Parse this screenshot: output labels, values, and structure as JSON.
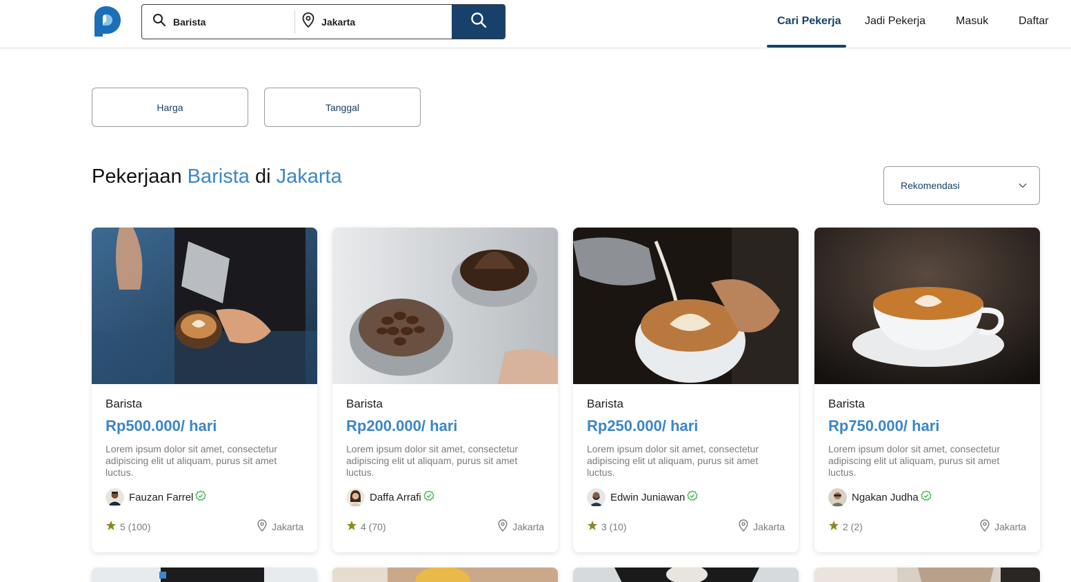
{
  "header": {
    "search": {
      "keyword": "Barista",
      "location": "Jakarta"
    },
    "nav": [
      {
        "label": "Cari Pekerja",
        "active": true
      },
      {
        "label": "Jadi  Pekerja",
        "active": false
      },
      {
        "label": "Masuk",
        "active": false
      },
      {
        "label": "Daftar",
        "active": false
      }
    ]
  },
  "filters": {
    "price_label": "Harga",
    "date_label": "Tanggal"
  },
  "heading": {
    "prefix": "Pekerjaan",
    "job": "Barista",
    "connector": "di",
    "city": "Jakarta"
  },
  "sort": {
    "selected": "Rekomendasi"
  },
  "cards": [
    {
      "title": "Barista",
      "price": "Rp500.000/ hari",
      "description": "Lorem ipsum dolor sit amet, consectetur adipiscing elit ut aliquam, purus sit amet luctus.",
      "owner": "Fauzan Farrel",
      "rating": "5 (100)",
      "location": "Jakarta"
    },
    {
      "title": "Barista",
      "price": "Rp200.000/ hari",
      "description": "Lorem ipsum dolor sit amet, consectetur adipiscing elit ut aliquam, purus sit amet luctus.",
      "owner": "Daffa Arrafi",
      "rating": "4 (70)",
      "location": "Jakarta"
    },
    {
      "title": "Barista",
      "price": "Rp250.000/ hari",
      "description": "Lorem ipsum dolor sit amet, consectetur adipiscing elit ut aliquam, purus sit amet luctus.",
      "owner": "Edwin Juniawan",
      "rating": "3 (10)",
      "location": "Jakarta"
    },
    {
      "title": "Barista",
      "price": "Rp750.000/ hari",
      "description": "Lorem ipsum dolor sit amet, consectetur adipiscing elit ut aliquam, purus sit amet luctus.",
      "owner": "Ngakan Judha",
      "rating": "2 (2)",
      "location": "Jakarta"
    }
  ],
  "colors": {
    "primary": "#17416a",
    "accent": "#3a86c8",
    "star": "#8a8a1e",
    "verified": "#3fb34f"
  },
  "icons": {
    "logo": "brand-p-logo",
    "search": "search-icon",
    "location": "map-pin-icon",
    "chevron": "chevron-down-icon",
    "star": "star-icon",
    "verified": "verified-badge-icon"
  }
}
